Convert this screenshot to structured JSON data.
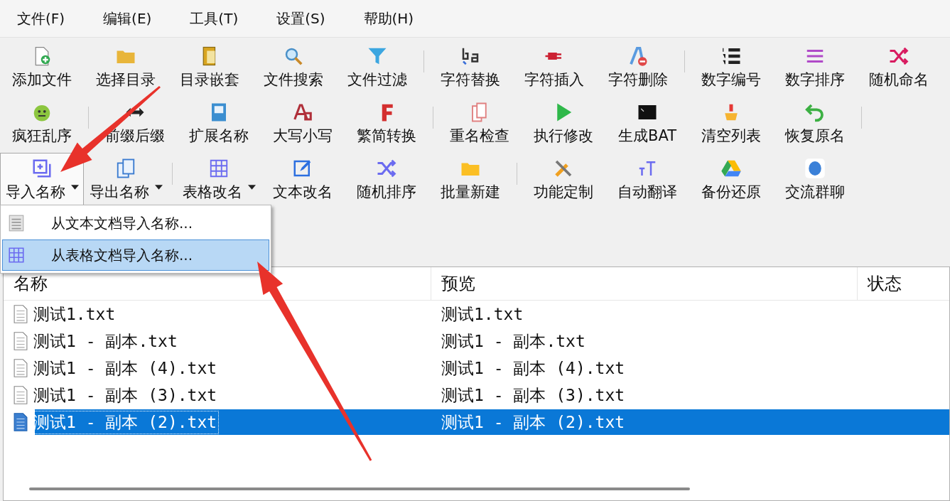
{
  "menu_bar": [
    "文件(F)",
    "编辑(E)",
    "工具(T)",
    "设置(S)",
    "帮助(H)"
  ],
  "toolbar": {
    "rows": [
      {
        "end_separator": false,
        "groups": [
          [
            {
              "label": "添加文件",
              "dropdown": false,
              "pressed": false
            },
            {
              "label": "选择目录",
              "dropdown": false,
              "pressed": false
            },
            {
              "label": "目录嵌套",
              "dropdown": false,
              "pressed": false
            },
            {
              "label": "文件搜索",
              "dropdown": false,
              "pressed": false
            },
            {
              "label": "文件过滤",
              "dropdown": false,
              "pressed": false
            }
          ],
          [
            {
              "label": "字符替换",
              "dropdown": false,
              "pressed": false
            },
            {
              "label": "字符插入",
              "dropdown": false,
              "pressed": false
            },
            {
              "label": "字符删除",
              "dropdown": false,
              "pressed": false
            }
          ],
          [
            {
              "label": "数字编号",
              "dropdown": false,
              "pressed": false
            },
            {
              "label": "数字排序",
              "dropdown": false,
              "pressed": false
            },
            {
              "label": "随机命名",
              "dropdown": false,
              "pressed": false
            }
          ]
        ]
      },
      {
        "end_separator": true,
        "groups": [
          [
            {
              "label": "疯狂乱序",
              "dropdown": false,
              "pressed": false
            }
          ],
          [
            {
              "label": "前缀后缀",
              "dropdown": false,
              "pressed": false
            },
            {
              "label": "扩展名称",
              "dropdown": false,
              "pressed": false
            },
            {
              "label": "大写小写",
              "dropdown": false,
              "pressed": false
            },
            {
              "label": "繁简转换",
              "dropdown": false,
              "pressed": false
            }
          ],
          [
            {
              "label": "重名检查",
              "dropdown": false,
              "pressed": false
            },
            {
              "label": "执行修改",
              "dropdown": false,
              "pressed": false
            },
            {
              "label": "生成BAT",
              "dropdown": false,
              "pressed": false
            },
            {
              "label": "清空列表",
              "dropdown": false,
              "pressed": false
            },
            {
              "label": "恢复原名",
              "dropdown": false,
              "pressed": false
            }
          ]
        ]
      },
      {
        "end_separator": false,
        "groups": [
          [
            {
              "label": "导入名称",
              "dropdown": true,
              "pressed": true
            },
            {
              "label": "导出名称",
              "dropdown": true,
              "pressed": false
            }
          ],
          [
            {
              "label": "表格改名",
              "dropdown": true,
              "pressed": false
            },
            {
              "label": "文本改名",
              "dropdown": false,
              "pressed": false
            },
            {
              "label": "随机排序",
              "dropdown": false,
              "pressed": false
            },
            {
              "label": "批量新建",
              "dropdown": false,
              "pressed": false
            }
          ],
          [
            {
              "label": "功能定制",
              "dropdown": false,
              "pressed": false
            },
            {
              "label": "自动翻译",
              "dropdown": false,
              "pressed": false
            },
            {
              "label": "备份还原",
              "dropdown": false,
              "pressed": false
            },
            {
              "label": "交流群聊",
              "dropdown": false,
              "pressed": false
            }
          ]
        ]
      }
    ]
  },
  "import_menu": {
    "items": [
      {
        "label": "从文本文档导入名称...",
        "selected": false
      },
      {
        "label": "从表格文档导入名称...",
        "selected": true
      }
    ]
  },
  "table": {
    "columns": [
      "名称",
      "预览",
      "状态"
    ],
    "rows": [
      {
        "name": "测试1.txt",
        "preview": "测试1.txt",
        "selected": false
      },
      {
        "name": "测试1 - 副本.txt",
        "preview": "测试1 - 副本.txt",
        "selected": false
      },
      {
        "name": "测试1 - 副本 (4).txt",
        "preview": "测试1 - 副本 (4).txt",
        "selected": false
      },
      {
        "name": "测试1 - 副本 (3).txt",
        "preview": "测试1 - 副本 (3).txt",
        "selected": false
      },
      {
        "name": "测试1 - 副本 (2).txt",
        "preview": "测试1 - 副本 (2).txt",
        "selected": true
      }
    ]
  }
}
